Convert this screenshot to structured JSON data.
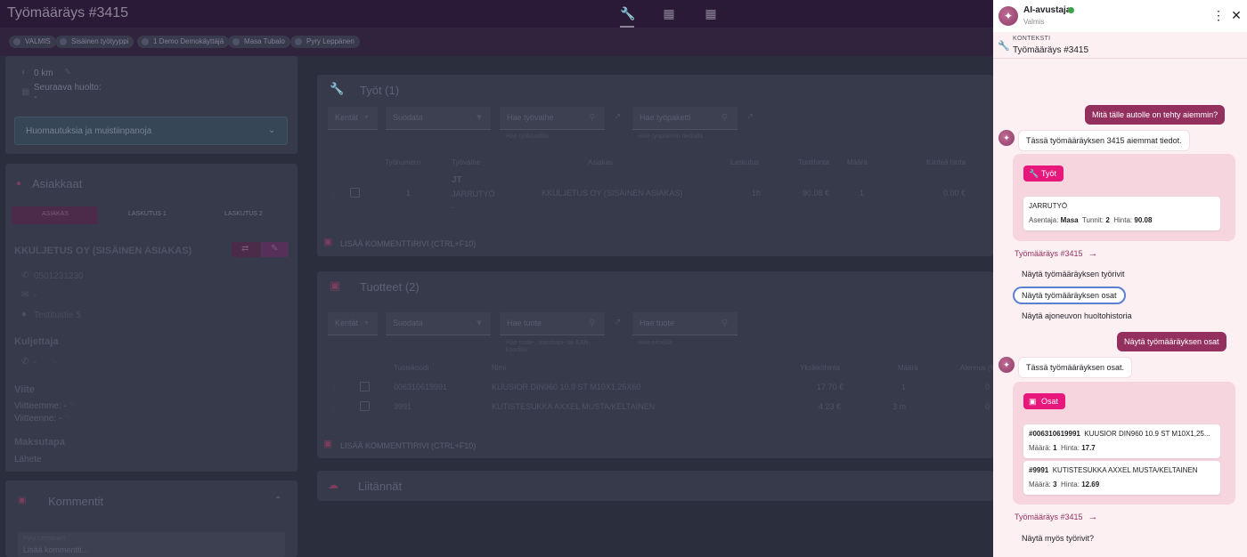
{
  "app": {
    "title": "Työmääräys #3415"
  },
  "chips": [
    "VALMIS",
    "Sisäinen työtyyppi",
    "1 Demo Demokäyttäjä",
    "Masa Tubalo",
    "Pyry Leppänen"
  ],
  "left": {
    "km": "0 km",
    "next_service_label": "Seuraava huolto:",
    "next_service_value": "-",
    "notes_label": "Huomautuksia ja muistiinpanoja",
    "customers_title": "Asiakkaat",
    "customer_tabs": [
      "ASIAKAS",
      "LASKUTUS 1",
      "LASKUTUS 2"
    ],
    "customer_name": "KKULJETUS OY (SISÄINEN ASIAKAS)",
    "phone": "0501231230",
    "email": "-",
    "address": "Testitustie 5",
    "driver_title": "Kuljettaja",
    "driver_phone": "-",
    "ref_title": "Viite",
    "ref_ours": "Viitteemme: -",
    "ref_theirs": "Viitteenne: -",
    "payment_title": "Maksutapa",
    "payment_value": "Lähete",
    "comments_title": "Kommentit",
    "comment_author": "Pyry Leppänen",
    "comment_placeholder": "Lisää kommentti..."
  },
  "works": {
    "title": "Työt (1)",
    "fields_label": "Kentät",
    "filter_placeholder": "Suodata",
    "search_phase": "Hae työvaihe",
    "search_phase_hint": "Hae työkoodilla",
    "search_package": "Hae työpaketti",
    "search_package_hint": "Hae työpaketin tiedoilla",
    "headers": [
      "Työnumero",
      "Työvaihe",
      "Asiakas",
      "Laskutus",
      "Tuntihinta",
      "Määrä",
      "Kiinteä hinta"
    ],
    "rows": [
      {
        "num": "1",
        "code": "JT",
        "phase": "JARRUTYÖ",
        "dash": "-",
        "customer": "KKULJETUS OY (SISÄINEN ASIAKAS)",
        "billing": "1h",
        "rate": "90.08 €",
        "qty": "1",
        "fixed": "0.00 €"
      }
    ],
    "add_comment": "LISÄÄ KOMMENTTIRIVI (CTRL+F10)"
  },
  "products": {
    "title": "Tuotteet (2)",
    "fields_label": "Kentät",
    "filter_placeholder": "Suodata",
    "search_product": "Hae tuote",
    "search_product_hint": "Hae tuote-, toimittaja- tai EAN-koodilla",
    "search_package": "Hae tuote",
    "search_package_hint": "Hae nimellä",
    "headers": [
      "Tuotekoodi",
      "Nimi",
      "Yksikköhinta",
      "Määrä",
      "Alennus (%)"
    ],
    "rows": [
      {
        "code": "006310619991",
        "name": "KUUSIOR DIN960 10.9 ST M10X1,25X60",
        "price": "17.70 €",
        "qty": "1",
        "disc": "0"
      },
      {
        "code": "9991",
        "name": "KUTISTESUKKA AXXEL MUSTA/KELTAINEN",
        "price": "4.23 €",
        "qty": "3 m",
        "disc": "0"
      }
    ],
    "add_comment": "LISÄÄ KOMMENTTIRIVI (CTRL+F10)"
  },
  "attachments": {
    "title": "Liitännät"
  },
  "assistant": {
    "name": "AI-avustaja",
    "status": "Valmis",
    "context_label": "KONTEKSTI",
    "context_title": "Työmääräys #3415",
    "msg_user_1": "Mitä tälle autolle on tehty aiemmin?",
    "msg_ai_1": "Tässä työmääräyksen 3415 aiemmat tiedot.",
    "works_pill": "Työt",
    "work_item": {
      "name": "JARRUTYÖ",
      "mechanic_label": "Asentaja:",
      "mechanic": "Masa",
      "hours_label": "Tunnit:",
      "hours": "2",
      "price_label": "Hinta:",
      "price": "90.08"
    },
    "link_1": "Työmääräys #3415",
    "suggestions_1": [
      "Näytä työmääräyksen työrivit",
      "Näytä työmääräyksen osat",
      "Näytä ajoneuvon huoltohistoria"
    ],
    "msg_user_2": "Näytä työmääräyksen osat",
    "msg_ai_2": "Tässä työmääräyksen osat.",
    "parts_pill": "Osat",
    "parts": [
      {
        "code": "#006310619991",
        "name": "KUUSIOR DIN960 10.9 ST M10X1,25...",
        "qty_label": "Määrä:",
        "qty": "1",
        "price_label": "Hinta:",
        "price": "17.7"
      },
      {
        "code": "#9991",
        "name": "KUTISTESUKKA AXXEL MUSTA/KELTAINEN",
        "qty_label": "Määrä:",
        "qty": "3",
        "price_label": "Hinta:",
        "price": "12.69"
      }
    ],
    "link_2": "Työmääräys #3415",
    "suggestion_2": "Näytä myös työrivit?"
  },
  "colors": {
    "accent": "#e7177c",
    "user_bubble": "#93305e",
    "focus_ring": "#5d7fd1",
    "online": "#3ea24a"
  }
}
